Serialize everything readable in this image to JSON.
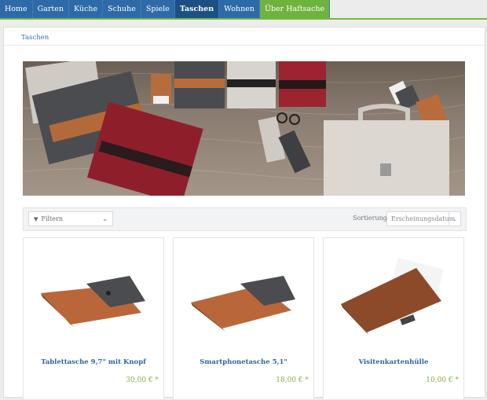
{
  "nav": {
    "items": [
      {
        "label": "Home",
        "state": "normal"
      },
      {
        "label": "Garten",
        "state": "normal"
      },
      {
        "label": "Küche",
        "state": "normal"
      },
      {
        "label": "Schuhe",
        "state": "normal"
      },
      {
        "label": "Spiele",
        "state": "normal"
      },
      {
        "label": "Taschen",
        "state": "active"
      },
      {
        "label": "Wohnen",
        "state": "normal"
      },
      {
        "label": "Über Haftsache",
        "state": "green"
      }
    ]
  },
  "breadcrumb": "Taschen",
  "filters": {
    "filter_label": "Filtern",
    "sort_label": "Sortierung:",
    "sort_value": "Erscheinungsdatum"
  },
  "products": [
    {
      "title": "Tablettasche 9,7\" mit Knopf",
      "price": "30,00 € *"
    },
    {
      "title": "Smartphonetasche 5,1\"",
      "price": "18,00 € *"
    },
    {
      "title": "Visitenkartenhülle",
      "price": "10,00 € *"
    }
  ],
  "colors": {
    "nav_blue": "#2d6aa7",
    "nav_active": "#1c4f84",
    "nav_green": "#6eb33d",
    "price_green": "#7cb342",
    "link_blue": "#2f63a0"
  }
}
